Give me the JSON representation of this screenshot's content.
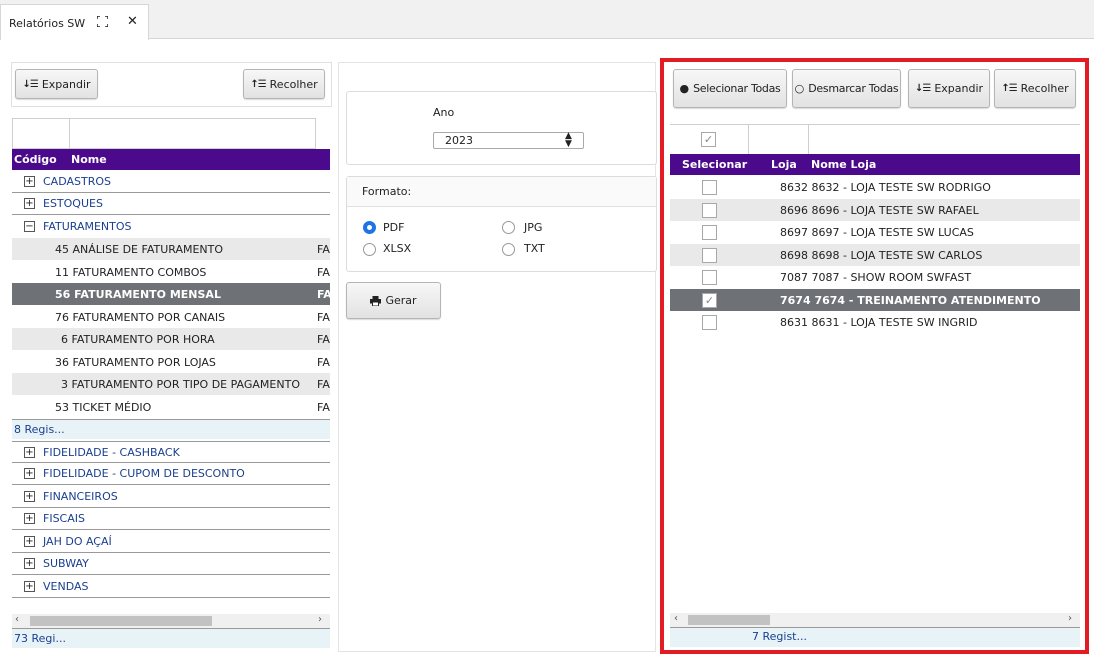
{
  "tab": {
    "title": "Relatórios SW",
    "close": "✕"
  },
  "left": {
    "expand_label": "Expandir",
    "collapse_label": "Recolher",
    "headers": {
      "code": "Código",
      "name": "Nome"
    },
    "groups_top": [
      "CADASTROS",
      "ESTOQUES",
      "FATURAMENTOS"
    ],
    "sub_items": [
      {
        "code": "45",
        "name": "ANÁLISE DE FATURAMENTO",
        "fa": "FA"
      },
      {
        "code": "11",
        "name": "FATURAMENTO COMBOS",
        "fa": "FA"
      },
      {
        "code": "56",
        "name": "FATURAMENTO MENSAL",
        "fa": "FA"
      },
      {
        "code": "76",
        "name": "FATURAMENTO POR CANAIS",
        "fa": "FA"
      },
      {
        "code": "6",
        "name": "FATURAMENTO POR HORA",
        "fa": "FA"
      },
      {
        "code": "36",
        "name": "FATURAMENTO POR LOJAS",
        "fa": "FA"
      },
      {
        "code": "3",
        "name": "FATURAMENTO POR TIPO DE PAGAMENTO",
        "fa": "FA"
      },
      {
        "code": "53",
        "name": "TICKET MÉDIO",
        "fa": "FA"
      }
    ],
    "sub_records": "8 Regis...",
    "groups_bottom": [
      "FIDELIDADE - CASHBACK",
      "FIDELIDADE - CUPOM DE DESCONTO",
      "FINANCEIROS",
      "FISCAIS",
      "JAH DO AÇAÍ",
      "SUBWAY",
      "VENDAS"
    ],
    "total_records": "73 Regi..."
  },
  "middle": {
    "year_label": "Ano",
    "year_value": "2023",
    "format_label": "Formato:",
    "formats": {
      "pdf": "PDF",
      "jpg": "JPG",
      "xlsx": "XLSX",
      "txt": "TXT"
    },
    "selected_format": "PDF",
    "generate_label": "Gerar"
  },
  "right": {
    "select_all_label": "Selecionar Todas",
    "deselect_all_label": "Desmarcar Todas",
    "expand_label": "Expandir",
    "collapse_label": "Recolher",
    "headers": {
      "select": "Selecionar",
      "store": "Loja",
      "store_name": "Nome Loja"
    },
    "rows": [
      {
        "text": "8632 8632 - LOJA TESTE SW RODRIGO",
        "checked": false
      },
      {
        "text": "8696 8696 - LOJA TESTE SW RAFAEL",
        "checked": false
      },
      {
        "text": "8697 8697 - LOJA TESTE SW LUCAS",
        "checked": false
      },
      {
        "text": "8698 8698 - LOJA TESTE SW CARLOS",
        "checked": false
      },
      {
        "text": "7087 7087 - SHOW ROOM SWFAST",
        "checked": false
      },
      {
        "text": "7674 7674 - TREINAMENTO ATENDIMENTO",
        "checked": true
      },
      {
        "text": "8631 8631 - LOJA TESTE SW INGRID",
        "checked": false
      }
    ],
    "records": "7 Regist..."
  },
  "colors": {
    "header_purple": "#4b0a8b",
    "selected_row": "#6e7176",
    "highlight_border": "#e31b23",
    "radio_on": "#1e74e6"
  }
}
